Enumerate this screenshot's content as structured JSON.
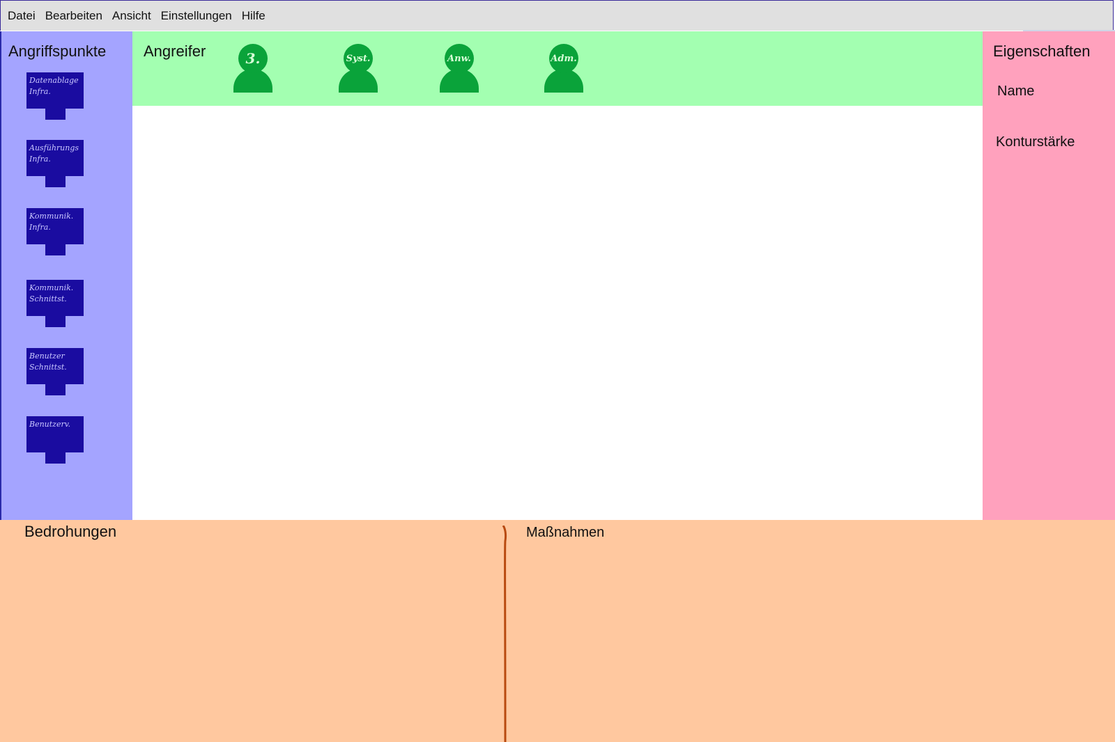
{
  "menu": [
    "Datei",
    "Bearbeiten",
    "Ansicht",
    "Einstellungen",
    "Hilfe"
  ],
  "attack_points": {
    "title": "Angriffspunkte",
    "items": [
      {
        "label": "Datenablage\nInfra."
      },
      {
        "label": "Ausführungs\nInfra."
      },
      {
        "label": "Kommunik.\nInfra."
      },
      {
        "label": "Kommunik.\nSchnittst."
      },
      {
        "label": "Benutzer\nSchnittst."
      },
      {
        "label": "Benutzerv."
      }
    ]
  },
  "attackers": {
    "title": "Angreifer",
    "items": [
      {
        "label": "3."
      },
      {
        "label": "Syst."
      },
      {
        "label": "Anw."
      },
      {
        "label": "Adm."
      }
    ]
  },
  "properties": {
    "title": "Eigenschaften",
    "fields": [
      "Name",
      "Konturstärke"
    ]
  },
  "threats": {
    "title": "Bedrohungen"
  },
  "measures": {
    "title": "Maßnahmen"
  },
  "colors": {
    "attack_points_bg": "#a4a4ff",
    "attack_point_icon": "#1a0ca0",
    "attackers_bg": "#a3ffb1",
    "attacker_icon": "#0aa33a",
    "properties_bg": "#ffa1bd",
    "bottom_bg": "#ffc89f",
    "divider": "#b84a10"
  }
}
